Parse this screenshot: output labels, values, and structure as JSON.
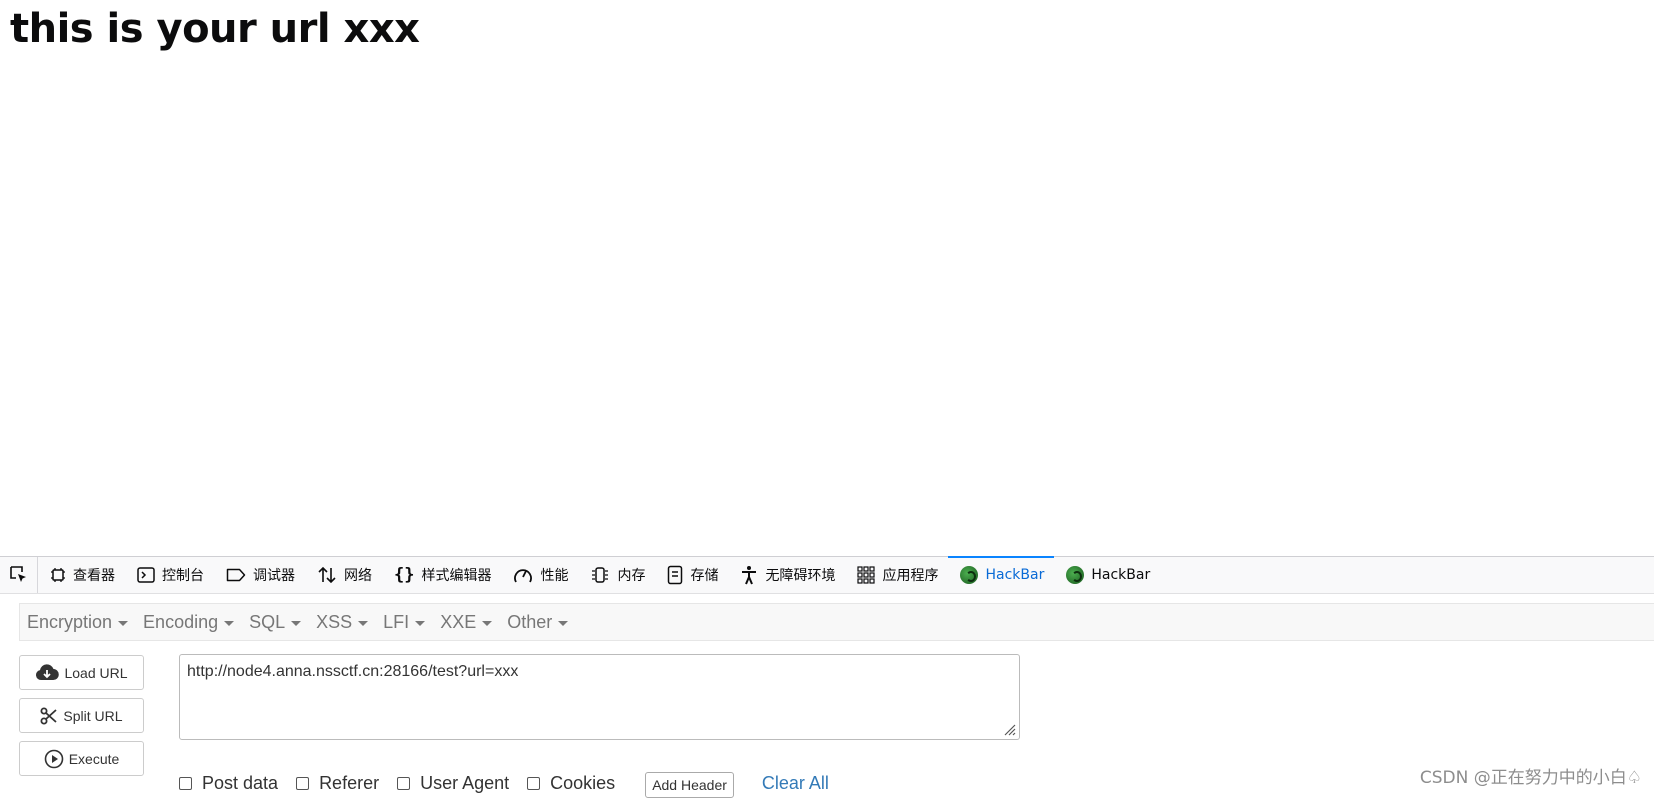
{
  "page": {
    "heading": "this is your url xxx"
  },
  "devtools": {
    "tabs": [
      {
        "label": "查看器",
        "icon": "inspector-icon"
      },
      {
        "label": "控制台",
        "icon": "console-icon"
      },
      {
        "label": "调试器",
        "icon": "debugger-icon"
      },
      {
        "label": "网络",
        "icon": "network-icon"
      },
      {
        "label": "样式编辑器",
        "icon": "style-editor-icon"
      },
      {
        "label": "性能",
        "icon": "performance-icon"
      },
      {
        "label": "内存",
        "icon": "memory-icon"
      },
      {
        "label": "存储",
        "icon": "storage-icon"
      },
      {
        "label": "无障碍环境",
        "icon": "accessibility-icon"
      },
      {
        "label": "应用程序",
        "icon": "application-icon"
      },
      {
        "label": "HackBar",
        "icon": "hackbar-icon",
        "active": true
      },
      {
        "label": "HackBar",
        "icon": "hackbar-icon"
      }
    ],
    "active_color": "#0a6bd6"
  },
  "hackbar": {
    "menu": [
      "Encryption",
      "Encoding",
      "SQL",
      "XSS",
      "LFI",
      "XXE",
      "Other"
    ],
    "buttons": {
      "load_url": "Load URL",
      "split_url": "Split URL",
      "execute": "Execute"
    },
    "url_value": "http://node4.anna.nssctf.cn:28166/test?url=xxx",
    "options": [
      "Post data",
      "Referer",
      "User Agent",
      "Cookies"
    ],
    "add_header": "Add Header",
    "clear_all": "Clear All",
    "link_color": "#337ab7"
  },
  "watermark": "CSDN @正在努力中的小白♤"
}
